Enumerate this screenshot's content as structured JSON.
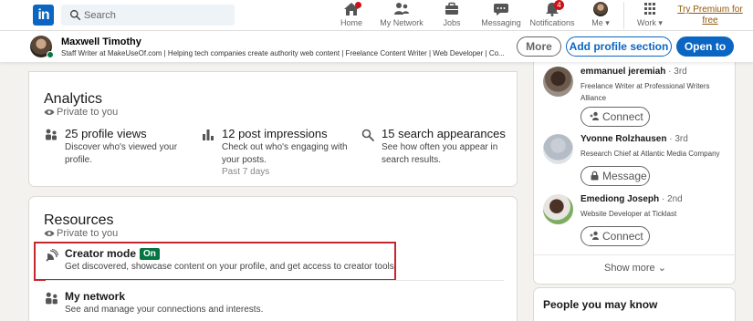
{
  "nav": {
    "logo": "in",
    "search_placeholder": "Search",
    "items": [
      {
        "label": "Home",
        "icon": "home-icon"
      },
      {
        "label": "My Network",
        "icon": "network-icon"
      },
      {
        "label": "Jobs",
        "icon": "briefcase-icon"
      },
      {
        "label": "Messaging",
        "icon": "messaging-icon"
      },
      {
        "label": "Notifications",
        "icon": "bell-icon",
        "badge": "4"
      },
      {
        "label": "Me",
        "icon": "avatar"
      },
      {
        "label": "Work",
        "icon": "grid-icon"
      }
    ],
    "premium": "Try Premium for free"
  },
  "profile_bar": {
    "name": "Maxwell Timothy",
    "headline": "Staff Writer at MakeUseOf.com | Helping tech companies create authority web content | Freelance Content Writer | Web Developer | Co...",
    "more_label": "More",
    "add_section_label": "Add profile section",
    "open_to_label": "Open to"
  },
  "analytics": {
    "title": "Analytics",
    "visibility": "Private to you",
    "stats": [
      {
        "title": "25 profile views",
        "desc": "Discover who's viewed your profile.",
        "meta": "",
        "icon": "people-icon"
      },
      {
        "title": "12 post impressions",
        "desc": "Check out who's engaging with your posts.",
        "meta": "Past 7 days",
        "icon": "bar-chart-icon"
      },
      {
        "title": "15 search appearances",
        "desc": "See how often you appear in search results.",
        "meta": "",
        "icon": "search-icon"
      }
    ]
  },
  "resources": {
    "title": "Resources",
    "visibility": "Private to you",
    "items": [
      {
        "title": "Creator mode",
        "status": "On",
        "desc": "Get discovered, showcase content on your profile, and get access to creator tools",
        "icon": "satellite-icon"
      },
      {
        "title": "My network",
        "desc": "See and manage your connections and interests.",
        "icon": "people-icon"
      }
    ]
  },
  "people": [
    {
      "name": "emmanuel jeremiah",
      "degree": "· 3rd",
      "title": "Freelance Writer at Professional Writers Alliance",
      "action": "Connect"
    },
    {
      "name": "Yvonne Rolzhausen",
      "degree": "· 3rd",
      "title": "Research Chief at Atlantic Media Company",
      "action": "Message"
    },
    {
      "name": "Emediong Joseph",
      "degree": "· 2nd",
      "title": "Website Developer at Ticklast",
      "action": "Connect"
    }
  ],
  "show_more": "Show more",
  "people_you_may_know": "People you may know",
  "colors": {
    "brand": "#0a66c2",
    "badge": "#cc1016",
    "on_pill": "#057642",
    "highlight": "#c5272e",
    "premium": "#915907"
  }
}
